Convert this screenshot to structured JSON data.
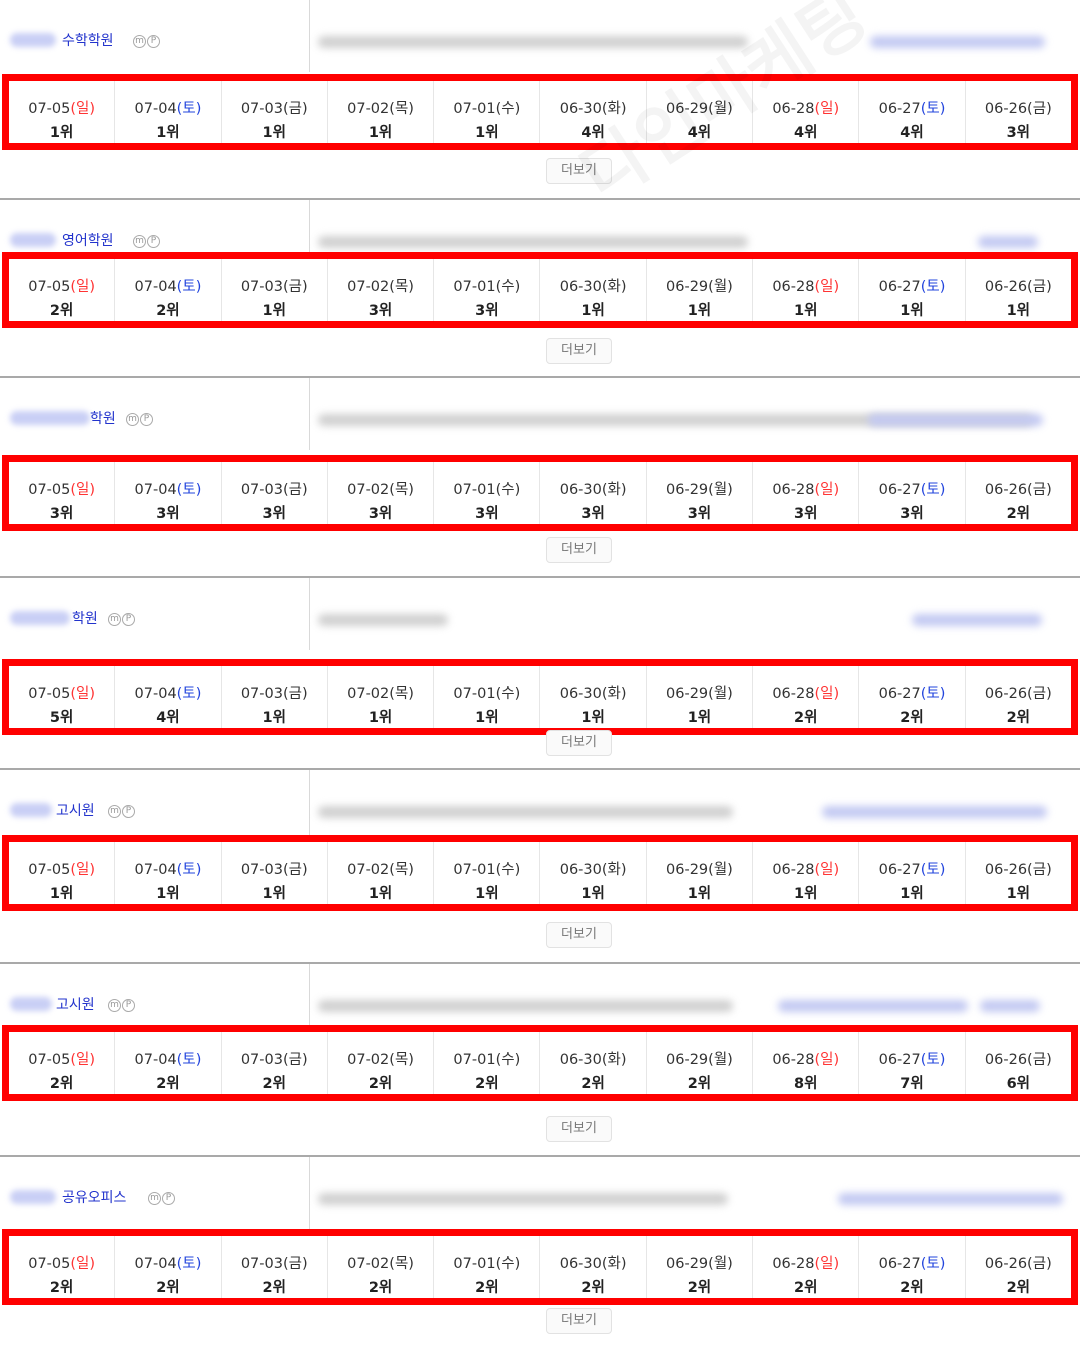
{
  "more_label": "더보기",
  "watermark": "다인마케팅",
  "colors": {
    "sunday": "#ff3333",
    "saturday": "#2244dd",
    "highlight_border": "#ff0000",
    "keyword": "#2233cc"
  },
  "mp_icons": [
    "m",
    "P"
  ],
  "sections": [
    {
      "keyword": "수학학원",
      "days": [
        {
          "date": "07-05",
          "weekday": "일",
          "rank": "1위"
        },
        {
          "date": "07-04",
          "weekday": "토",
          "rank": "1위"
        },
        {
          "date": "07-03",
          "weekday": "금",
          "rank": "1위"
        },
        {
          "date": "07-02",
          "weekday": "목",
          "rank": "1위"
        },
        {
          "date": "07-01",
          "weekday": "수",
          "rank": "1위"
        },
        {
          "date": "06-30",
          "weekday": "화",
          "rank": "4위"
        },
        {
          "date": "06-29",
          "weekday": "월",
          "rank": "4위"
        },
        {
          "date": "06-28",
          "weekday": "일",
          "rank": "4위"
        },
        {
          "date": "06-27",
          "weekday": "토",
          "rank": "4위"
        },
        {
          "date": "06-26",
          "weekday": "금",
          "rank": "3위"
        }
      ]
    },
    {
      "keyword": "영어학원",
      "days": [
        {
          "date": "07-05",
          "weekday": "일",
          "rank": "2위"
        },
        {
          "date": "07-04",
          "weekday": "토",
          "rank": "2위"
        },
        {
          "date": "07-03",
          "weekday": "금",
          "rank": "1위"
        },
        {
          "date": "07-02",
          "weekday": "목",
          "rank": "3위"
        },
        {
          "date": "07-01",
          "weekday": "수",
          "rank": "3위"
        },
        {
          "date": "06-30",
          "weekday": "화",
          "rank": "1위"
        },
        {
          "date": "06-29",
          "weekday": "월",
          "rank": "1위"
        },
        {
          "date": "06-28",
          "weekday": "일",
          "rank": "1위"
        },
        {
          "date": "06-27",
          "weekday": "토",
          "rank": "1위"
        },
        {
          "date": "06-26",
          "weekday": "금",
          "rank": "1위"
        }
      ]
    },
    {
      "keyword": "학원",
      "days": [
        {
          "date": "07-05",
          "weekday": "일",
          "rank": "3위"
        },
        {
          "date": "07-04",
          "weekday": "토",
          "rank": "3위"
        },
        {
          "date": "07-03",
          "weekday": "금",
          "rank": "3위"
        },
        {
          "date": "07-02",
          "weekday": "목",
          "rank": "3위"
        },
        {
          "date": "07-01",
          "weekday": "수",
          "rank": "3위"
        },
        {
          "date": "06-30",
          "weekday": "화",
          "rank": "3위"
        },
        {
          "date": "06-29",
          "weekday": "월",
          "rank": "3위"
        },
        {
          "date": "06-28",
          "weekday": "일",
          "rank": "3위"
        },
        {
          "date": "06-27",
          "weekday": "토",
          "rank": "3위"
        },
        {
          "date": "06-26",
          "weekday": "금",
          "rank": "2위"
        }
      ]
    },
    {
      "keyword": "학원",
      "days": [
        {
          "date": "07-05",
          "weekday": "일",
          "rank": "5위"
        },
        {
          "date": "07-04",
          "weekday": "토",
          "rank": "4위"
        },
        {
          "date": "07-03",
          "weekday": "금",
          "rank": "1위"
        },
        {
          "date": "07-02",
          "weekday": "목",
          "rank": "1위"
        },
        {
          "date": "07-01",
          "weekday": "수",
          "rank": "1위"
        },
        {
          "date": "06-30",
          "weekday": "화",
          "rank": "1위"
        },
        {
          "date": "06-29",
          "weekday": "월",
          "rank": "1위"
        },
        {
          "date": "06-28",
          "weekday": "일",
          "rank": "2위"
        },
        {
          "date": "06-27",
          "weekday": "토",
          "rank": "2위"
        },
        {
          "date": "06-26",
          "weekday": "금",
          "rank": "2위"
        }
      ]
    },
    {
      "keyword": "고시원",
      "days": [
        {
          "date": "07-05",
          "weekday": "일",
          "rank": "1위"
        },
        {
          "date": "07-04",
          "weekday": "토",
          "rank": "1위"
        },
        {
          "date": "07-03",
          "weekday": "금",
          "rank": "1위"
        },
        {
          "date": "07-02",
          "weekday": "목",
          "rank": "1위"
        },
        {
          "date": "07-01",
          "weekday": "수",
          "rank": "1위"
        },
        {
          "date": "06-30",
          "weekday": "화",
          "rank": "1위"
        },
        {
          "date": "06-29",
          "weekday": "월",
          "rank": "1위"
        },
        {
          "date": "06-28",
          "weekday": "일",
          "rank": "1위"
        },
        {
          "date": "06-27",
          "weekday": "토",
          "rank": "1위"
        },
        {
          "date": "06-26",
          "weekday": "금",
          "rank": "1위"
        }
      ]
    },
    {
      "keyword": "고시원",
      "days": [
        {
          "date": "07-05",
          "weekday": "일",
          "rank": "2위"
        },
        {
          "date": "07-04",
          "weekday": "토",
          "rank": "2위"
        },
        {
          "date": "07-03",
          "weekday": "금",
          "rank": "2위"
        },
        {
          "date": "07-02",
          "weekday": "목",
          "rank": "2위"
        },
        {
          "date": "07-01",
          "weekday": "수",
          "rank": "2위"
        },
        {
          "date": "06-30",
          "weekday": "화",
          "rank": "2위"
        },
        {
          "date": "06-29",
          "weekday": "월",
          "rank": "2위"
        },
        {
          "date": "06-28",
          "weekday": "일",
          "rank": "8위"
        },
        {
          "date": "06-27",
          "weekday": "토",
          "rank": "7위"
        },
        {
          "date": "06-26",
          "weekday": "금",
          "rank": "6위"
        }
      ]
    },
    {
      "keyword": "공유오피스",
      "days": [
        {
          "date": "07-05",
          "weekday": "일",
          "rank": "2위"
        },
        {
          "date": "07-04",
          "weekday": "토",
          "rank": "2위"
        },
        {
          "date": "07-03",
          "weekday": "금",
          "rank": "2위"
        },
        {
          "date": "07-02",
          "weekday": "목",
          "rank": "2위"
        },
        {
          "date": "07-01",
          "weekday": "수",
          "rank": "2위"
        },
        {
          "date": "06-30",
          "weekday": "화",
          "rank": "2위"
        },
        {
          "date": "06-29",
          "weekday": "월",
          "rank": "2위"
        },
        {
          "date": "06-28",
          "weekday": "일",
          "rank": "2위"
        },
        {
          "date": "06-27",
          "weekday": "토",
          "rank": "2위"
        },
        {
          "date": "06-26",
          "weekday": "금",
          "rank": "2위"
        }
      ]
    }
  ]
}
